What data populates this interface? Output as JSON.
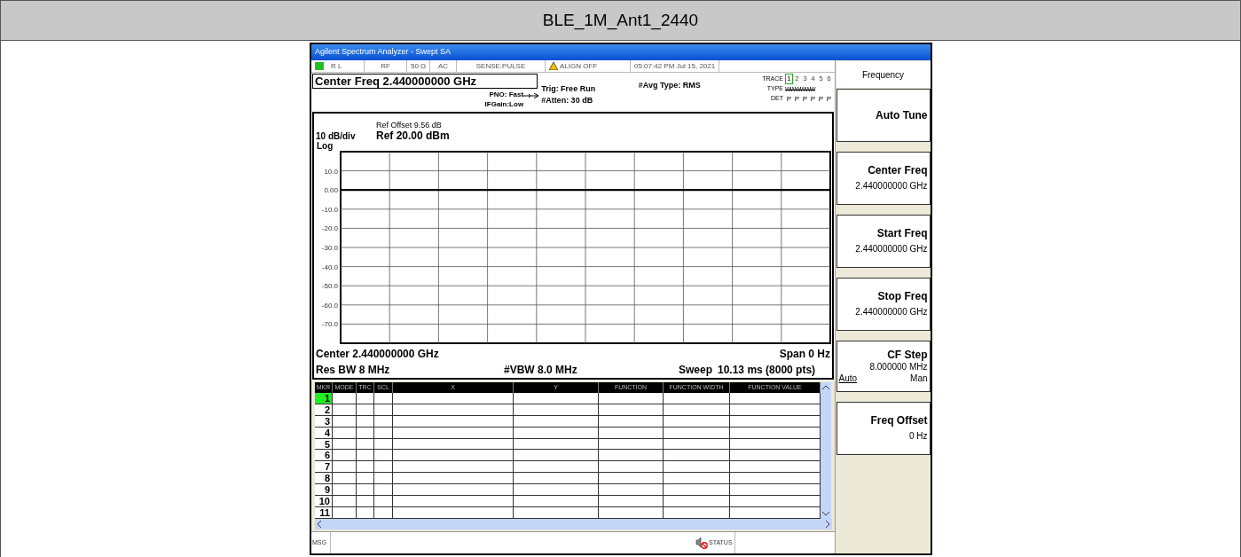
{
  "document_title": "BLE_1M_Ant1_2440",
  "analyzer": {
    "window_title": "Agilent Spectrum Analyzer - Swept SA",
    "status_items": [
      {
        "kind": "lxi",
        "text": "R L"
      },
      {
        "kind": "plain",
        "text": "RF"
      },
      {
        "kind": "plain",
        "text": "50 Ω"
      },
      {
        "kind": "plain",
        "text": "AC"
      },
      {
        "kind": "plain",
        "text": "SENSE:PULSE"
      },
      {
        "kind": "warning",
        "text": "ALIGN OFF"
      },
      {
        "kind": "plain",
        "text": "05:07:42 PM Jul 15, 2021"
      }
    ],
    "info": {
      "center_freq": "Center Freq 2.440000000 GHz",
      "pno": "PNO: Fast",
      "ifgain": "IFGain:Low",
      "trig": "Trig: Free Run",
      "atten": "#Atten: 30 dB",
      "avg_type": "#Avg Type: RMS",
      "trace_label": "TRACE",
      "traces": [
        {
          "label": "1",
          "selected": true
        },
        {
          "label": "2",
          "selected": false
        },
        {
          "label": "3",
          "selected": false
        },
        {
          "label": "4",
          "selected": false
        },
        {
          "label": "5",
          "selected": false
        },
        {
          "label": "6",
          "selected": false
        }
      ],
      "type_label": "TYPE",
      "types": "WWWWWW",
      "det_label": "DET",
      "detectors": [
        "P",
        "P",
        "P",
        "P",
        "P",
        "P"
      ]
    },
    "graph": {
      "ref_offset": "Ref Offset 9.56 dB",
      "scale": "10 dB/div",
      "ref": "Ref 20.00 dBm",
      "scale_type": "Log",
      "chart_data": {
        "type": "line",
        "grid": true,
        "ylim": [
          -80,
          20
        ],
        "yticks": [
          {
            "value": 10,
            "label": "10.0"
          },
          {
            "value": 0,
            "label": "0.00"
          },
          {
            "value": -10,
            "label": "-10.0"
          },
          {
            "value": -20,
            "label": "-20.0"
          },
          {
            "value": -30,
            "label": "-30.0"
          },
          {
            "value": -40,
            "label": "-40.0"
          },
          {
            "value": -50,
            "label": "-50.0"
          },
          {
            "value": -60,
            "label": "-60.0"
          },
          {
            "value": -70,
            "label": "-70.0"
          }
        ],
        "series": [
          {
            "color": "#000000",
            "values": [
              0,
              0,
              0,
              0,
              0,
              0,
              0,
              0,
              0,
              0,
              0
            ]
          }
        ]
      },
      "center": "Center 2.440000000 GHz",
      "span": "Span 0 Hz",
      "rbw": "Res BW 8 MHz",
      "vbw": "#VBW 8.0 MHz",
      "sweep_label": "Sweep",
      "sweep_value": "10.13 ms (8000 pts)"
    },
    "marker_table": {
      "columns": [
        "MKR",
        "MODE",
        "TRC",
        "SCL",
        "X",
        "Y",
        "FUNCTION",
        "FUNCTION WIDTH",
        "FUNCTION VALUE"
      ],
      "rows": [
        {
          "label": "1",
          "selected": true
        },
        {
          "label": "2",
          "selected": false
        },
        {
          "label": "3",
          "selected": false
        },
        {
          "label": "4",
          "selected": false
        },
        {
          "label": "5",
          "selected": false
        },
        {
          "label": "6",
          "selected": false
        },
        {
          "label": "7",
          "selected": false
        },
        {
          "label": "8",
          "selected": false
        },
        {
          "label": "9",
          "selected": false
        },
        {
          "label": "10",
          "selected": false
        },
        {
          "label": "11",
          "selected": false
        }
      ]
    },
    "msg_label": "MSG",
    "status_label": "STATUS",
    "softkeys": {
      "menu_title": "Frequency",
      "keys": [
        {
          "kind": "action",
          "label": "Auto Tune"
        },
        {
          "kind": "value",
          "label": "Center Freq",
          "value": "2.440000000 GHz"
        },
        {
          "kind": "value",
          "label": "Start Freq",
          "value": "2.440000000 GHz"
        },
        {
          "kind": "value",
          "label": "Stop Freq",
          "value": "2.440000000 GHz"
        },
        {
          "kind": "toggle",
          "label": "CF Step",
          "value": "8.000000 MHz",
          "options": [
            {
              "label": "Auto",
              "selected": true
            },
            {
              "label": "Man",
              "selected": false
            }
          ]
        },
        {
          "kind": "value",
          "label": "Freq Offset",
          "value": "0 Hz"
        }
      ]
    }
  }
}
